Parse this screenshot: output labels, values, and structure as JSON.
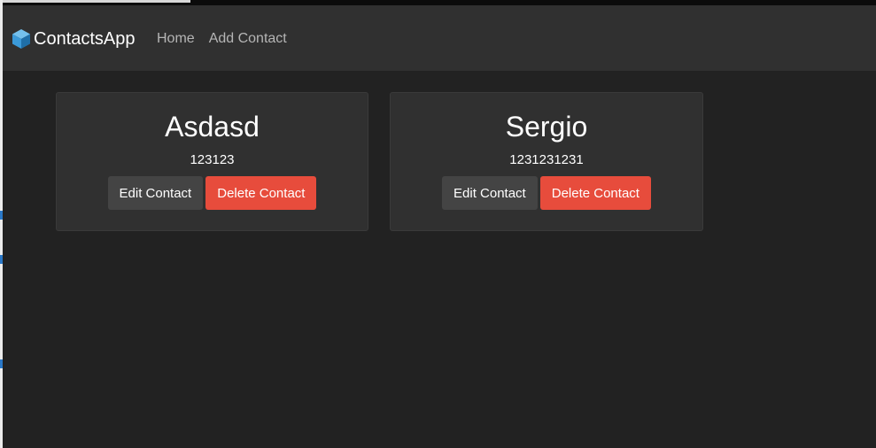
{
  "navbar": {
    "brand": "ContactsApp",
    "links": [
      "Home",
      "Add Contact"
    ]
  },
  "contacts": [
    {
      "name": "Asdasd",
      "phone": "123123",
      "edit_label": "Edit Contact",
      "delete_label": "Delete Contact"
    },
    {
      "name": "Sergio",
      "phone": "1231231231",
      "edit_label": "Edit Contact",
      "delete_label": "Delete Contact"
    }
  ],
  "colors": {
    "page_background": "#222222",
    "navbar_background": "#303030",
    "card_background": "#303030",
    "edit_button": "#444444",
    "delete_button": "#e74c3c",
    "nav_link_text": "#b5b5b5",
    "logo": "#3b9ad9"
  },
  "icons": {
    "brand": "cube-icon"
  }
}
